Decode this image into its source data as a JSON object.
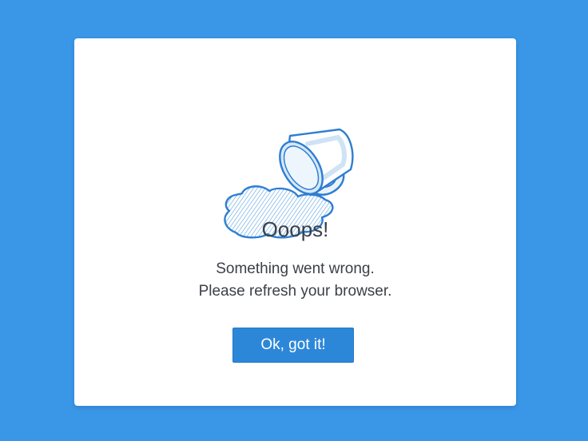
{
  "dialog": {
    "illustration": "spilled-cup-icon",
    "title": "Ooops!",
    "message_line1": "Something went wrong.",
    "message_line2": "Please refresh your browser.",
    "button_label": "Ok, got it!"
  },
  "colors": {
    "background": "#3a96e6",
    "dialog": "#ffffff",
    "button": "#2d87d8",
    "text": "#3b3f47",
    "illustration_stroke": "#2f7ed2"
  }
}
